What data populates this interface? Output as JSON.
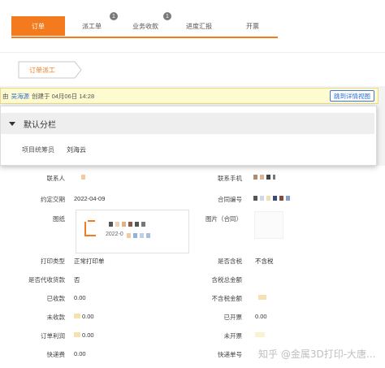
{
  "tabs": [
    {
      "label": "订单"
    },
    {
      "label": "派工单",
      "badge": "1"
    },
    {
      "label": "业务收款",
      "badge": "1"
    },
    {
      "label": "进度汇报"
    },
    {
      "label": "开票"
    }
  ],
  "breadcrumb": {
    "step": "订单派工"
  },
  "banner": {
    "prefix": "由",
    "creator": "吴海源",
    "created_at": "创建于 04月06日 14:28",
    "jump_button": "跳到详情视图"
  },
  "popover": {
    "section_title": "默认分栏",
    "field_label": "项目统筹员",
    "field_value": "刘海云"
  },
  "form": {
    "contact_label": "联系人",
    "contact_phone_label": "联系手机",
    "delivery_date_label": "约定交期",
    "delivery_date_value": "2022-04-09",
    "contract_no_label": "合同编号",
    "drawing_label": "图纸",
    "drawing_file_date": "2022-0",
    "contract_image_label": "图片（合同）",
    "print_type_label": "打印类型",
    "print_type_value": "正常打印单",
    "tax_included_label": "是否含税",
    "tax_included_value": "不含税",
    "agent_collect_label": "是否代收货款",
    "agent_collect_value": "否",
    "tax_total_label": "含税总金额",
    "received_label": "已收款",
    "received_value": "0.00",
    "untaxed_total_label": "不含税金额",
    "unreceived_label": "未收款",
    "unreceived_value": "0.00",
    "invoiced_label": "已开票",
    "invoiced_value": "0.00",
    "profit_label": "订单利润",
    "profit_value": "0.00",
    "uninvoiced_label": "未开票",
    "express_fee_label": "快递费",
    "express_fee_value": "0.00",
    "tracking_no_label": "快递单号"
  },
  "watermark": "知乎 @金属3D打印-大唐...",
  "colors": {
    "accent": "#f37b1d",
    "link": "#2d6fd1",
    "banner_bg": "#fffbd1"
  }
}
